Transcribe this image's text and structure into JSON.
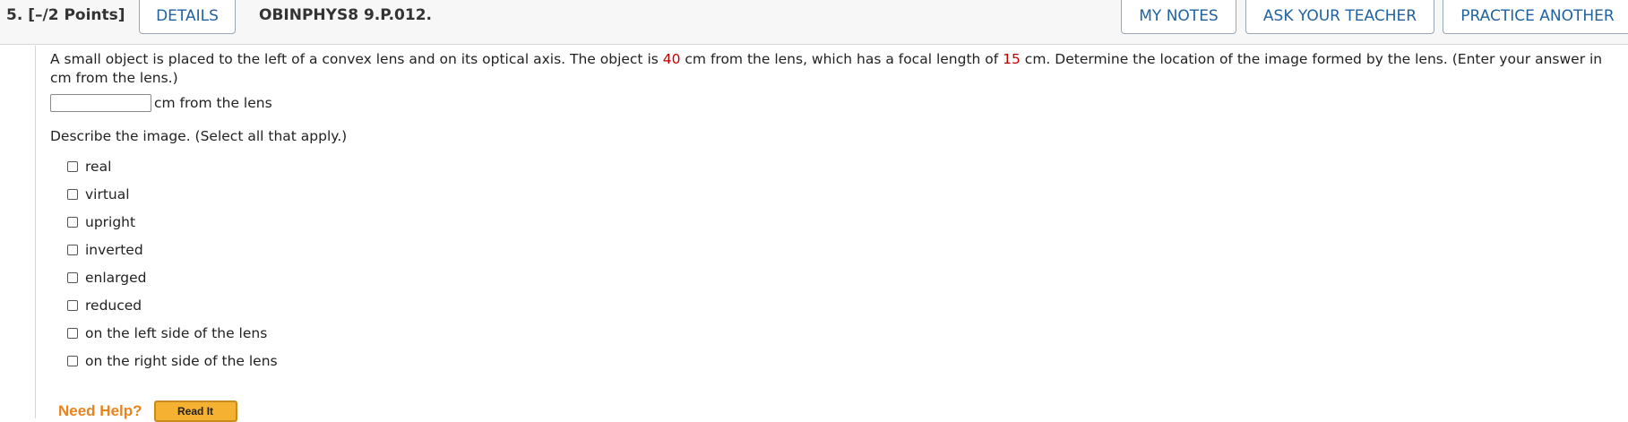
{
  "header": {
    "question_number": "5.",
    "points": "[–/2 Points]",
    "details_label": "DETAILS",
    "question_code": "OBINPHYS8 9.P.012.",
    "my_notes_label": "MY NOTES",
    "ask_teacher_label": "ASK YOUR TEACHER",
    "practice_another_label": "PRACTICE ANOTHER"
  },
  "question": {
    "text_part1": "A small object is placed to the left of a convex lens and on its optical axis. The object is ",
    "object_distance": "40",
    "text_part2": " cm from the lens, which has a focal length of ",
    "focal_length": "15",
    "text_part3": " cm. Determine the location of the image formed by the lens. (Enter your answer in cm from the lens.)",
    "answer_value": "",
    "answer_unit": "cm from the lens",
    "describe_prompt": "Describe the image. (Select all that apply.)",
    "options": [
      "real",
      "virtual",
      "upright",
      "inverted",
      "enlarged",
      "reduced",
      "on the left side of the lens",
      "on the right side of the lens"
    ]
  },
  "help": {
    "need_help_label": "Need Help?",
    "read_it_label": "Read It"
  },
  "colors": {
    "link_blue": "#2162a1",
    "highlight_red": "#c00000",
    "help_orange": "#e8831d",
    "read_it_bg": "#f5b232"
  }
}
